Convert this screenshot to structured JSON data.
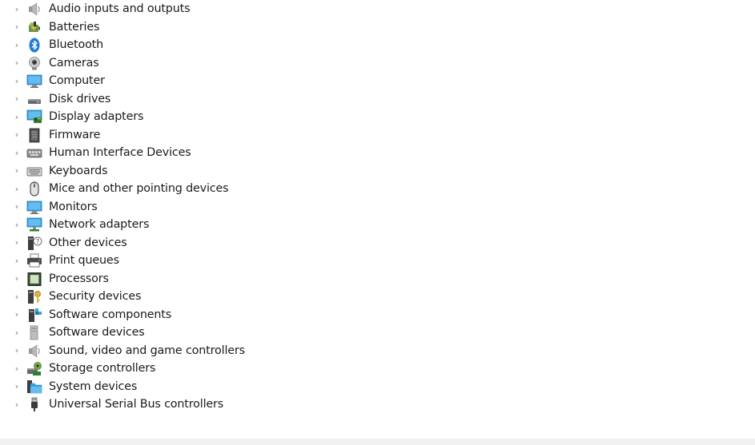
{
  "tree": {
    "expander_glyph": "›",
    "items": [
      {
        "label": "Audio inputs and outputs",
        "icon": "speaker-icon"
      },
      {
        "label": "Batteries",
        "icon": "battery-icon"
      },
      {
        "label": "Bluetooth",
        "icon": "bluetooth-icon"
      },
      {
        "label": "Cameras",
        "icon": "webcam-icon"
      },
      {
        "label": "Computer",
        "icon": "monitor-icon"
      },
      {
        "label": "Disk drives",
        "icon": "disk-drive-icon"
      },
      {
        "label": "Display adapters",
        "icon": "display-adapter-icon"
      },
      {
        "label": "Firmware",
        "icon": "firmware-chip-icon"
      },
      {
        "label": "Human Interface Devices",
        "icon": "hid-icon"
      },
      {
        "label": "Keyboards",
        "icon": "keyboard-icon"
      },
      {
        "label": "Mice and other pointing devices",
        "icon": "mouse-icon"
      },
      {
        "label": "Monitors",
        "icon": "monitor-icon"
      },
      {
        "label": "Network adapters",
        "icon": "network-adapter-icon"
      },
      {
        "label": "Other devices",
        "icon": "unknown-device-icon"
      },
      {
        "label": "Print queues",
        "icon": "printer-icon"
      },
      {
        "label": "Processors",
        "icon": "processor-icon"
      },
      {
        "label": "Security devices",
        "icon": "security-key-icon"
      },
      {
        "label": "Software components",
        "icon": "software-component-icon"
      },
      {
        "label": "Software devices",
        "icon": "software-device-icon"
      },
      {
        "label": "Sound, video and game controllers",
        "icon": "speaker-icon"
      },
      {
        "label": "Storage controllers",
        "icon": "storage-controller-icon"
      },
      {
        "label": "System devices",
        "icon": "system-folder-icon"
      },
      {
        "label": "Universal Serial Bus controllers",
        "icon": "usb-plug-icon"
      }
    ]
  },
  "colors": {
    "text": "#1b1b1b",
    "expander": "#7a7a7a",
    "monitor_blue": "#3aa0e0",
    "bluetooth_blue": "#1e7ad9",
    "status_strip": "#f0f0f0"
  }
}
